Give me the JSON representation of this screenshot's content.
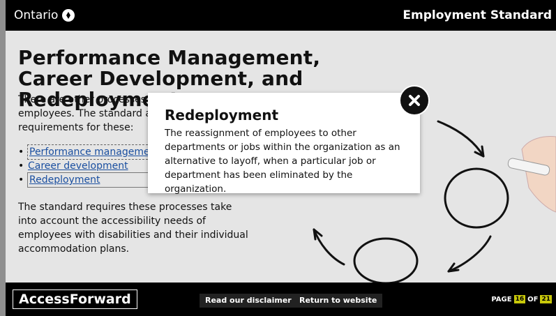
{
  "header": {
    "brand": "Ontario",
    "course_title": "Employment Standard"
  },
  "main": {
    "heading": "Performance Management, Career Development, and Redeployment",
    "intro": "There are other processes that affect employees. The standard also has requirements for these:",
    "links": [
      {
        "label": "Performance management"
      },
      {
        "label": "Career development"
      },
      {
        "label": "Redeployment"
      }
    ],
    "paragraph": "The standard requires these processes take into account the accessibility needs of employees with disabilities and their individual accommodation plans."
  },
  "popup": {
    "title": "Redeployment",
    "body": "The reassignment of employees to other departments or jobs within the organization as an alternative to layoff, when a particular job or department has been eliminated by the organization."
  },
  "footer": {
    "logo": "AccessForward",
    "disclaimer_button": "Read our disclaimer",
    "return_button": "Return to website",
    "page_label": "PAGE",
    "page_current": "16",
    "page_of": "OF",
    "page_total": "21"
  }
}
